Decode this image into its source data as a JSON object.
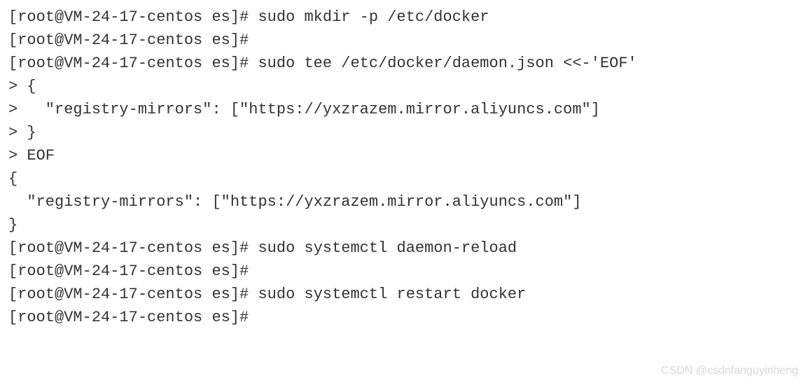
{
  "terminal": {
    "lines": [
      "[root@VM-24-17-centos es]# sudo mkdir -p /etc/docker",
      "[root@VM-24-17-centos es]#",
      "[root@VM-24-17-centos es]# sudo tee /etc/docker/daemon.json <<-'EOF'",
      "> {",
      ">   \"registry-mirrors\": [\"https://yxzrazem.mirror.aliyuncs.com\"]",
      "> }",
      "> EOF",
      "{",
      "  \"registry-mirrors\": [\"https://yxzrazem.mirror.aliyuncs.com\"]",
      "}",
      "[root@VM-24-17-centos es]# sudo systemctl daemon-reload",
      "[root@VM-24-17-centos es]#",
      "[root@VM-24-17-centos es]# sudo systemctl restart docker",
      "",
      "[root@VM-24-17-centos es]#"
    ]
  },
  "watermark": "CSDN @csdnfanguyinheng"
}
